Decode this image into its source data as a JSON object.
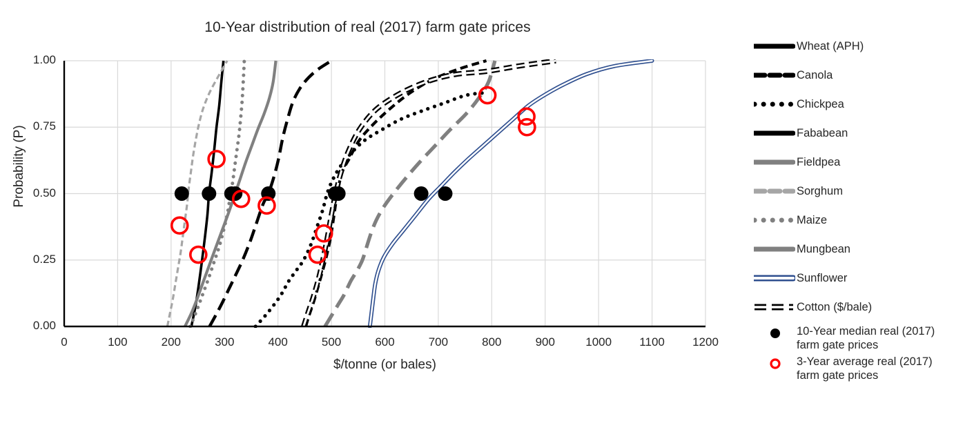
{
  "chart_data": {
    "type": "line",
    "title": "10-Year distribution of real (2017) farm gate prices",
    "xlabel": "$/tonne (or bales)",
    "ylabel": "Probability (P)",
    "xlim": [
      0,
      1200
    ],
    "ylim": [
      0,
      1
    ],
    "xticks": [
      0,
      100,
      200,
      300,
      400,
      500,
      600,
      700,
      800,
      900,
      1000,
      1100,
      1200
    ],
    "xtick_labels": [
      "0",
      "100",
      "200",
      "300",
      "400",
      "500",
      "600",
      "700",
      "800",
      "900",
      "1000",
      "1100",
      "1200"
    ],
    "yticks": [
      0,
      0.25,
      0.5,
      0.75,
      1.0
    ],
    "ytick_labels": [
      "0.00",
      "0.25",
      "0.50",
      "0.75",
      "1.00"
    ],
    "grid": true,
    "legend_position": "right",
    "series": [
      {
        "name": "Wheat (APH)",
        "style": "solid",
        "color": "#000000",
        "width": 3.6,
        "points": [
          [
            238,
            0.0
          ],
          [
            246,
            0.08
          ],
          [
            252,
            0.16
          ],
          [
            258,
            0.25
          ],
          [
            263,
            0.33
          ],
          [
            268,
            0.42
          ],
          [
            271,
            0.5
          ],
          [
            276,
            0.58
          ],
          [
            281,
            0.67
          ],
          [
            285,
            0.75
          ],
          [
            290,
            0.83
          ],
          [
            294,
            0.92
          ],
          [
            298,
            1.0
          ]
        ]
      },
      {
        "name": "Canola",
        "style": "dashed",
        "color": "#000000",
        "width": 4.2,
        "points": [
          [
            452,
            0.0
          ],
          [
            458,
            0.04
          ],
          [
            468,
            0.1
          ],
          [
            478,
            0.17
          ],
          [
            489,
            0.25
          ],
          [
            498,
            0.33
          ],
          [
            505,
            0.42
          ],
          [
            511,
            0.5
          ],
          [
            520,
            0.58
          ],
          [
            533,
            0.63
          ],
          [
            552,
            0.7
          ],
          [
            578,
            0.76
          ],
          [
            610,
            0.82
          ],
          [
            648,
            0.88
          ],
          [
            690,
            0.93
          ],
          [
            740,
            0.97
          ],
          [
            790,
            1.0
          ]
        ]
      },
      {
        "name": "Chickpea",
        "style": "dotted",
        "color": "#000000",
        "width": 5.2,
        "points": [
          [
            358,
            0.0
          ],
          [
            376,
            0.04
          ],
          [
            392,
            0.08
          ],
          [
            406,
            0.12
          ],
          [
            420,
            0.17
          ],
          [
            434,
            0.21
          ],
          [
            448,
            0.25
          ],
          [
            462,
            0.31
          ],
          [
            474,
            0.38
          ],
          [
            484,
            0.44
          ],
          [
            492,
            0.5
          ],
          [
            502,
            0.55
          ],
          [
            516,
            0.6
          ],
          [
            536,
            0.65
          ],
          [
            562,
            0.7
          ],
          [
            594,
            0.74
          ],
          [
            630,
            0.78
          ],
          [
            668,
            0.81
          ],
          [
            710,
            0.84
          ],
          [
            752,
            0.87
          ],
          [
            790,
            0.88
          ]
        ]
      },
      {
        "name": "Fababean",
        "style": "long-dash",
        "color": "#000000",
        "width": 4.4,
        "points": [
          [
            272,
            0.0
          ],
          [
            283,
            0.04
          ],
          [
            296,
            0.09
          ],
          [
            308,
            0.14
          ],
          [
            320,
            0.19
          ],
          [
            334,
            0.25
          ],
          [
            348,
            0.32
          ],
          [
            360,
            0.39
          ],
          [
            372,
            0.46
          ],
          [
            382,
            0.5
          ],
          [
            392,
            0.56
          ],
          [
            401,
            0.63
          ],
          [
            409,
            0.71
          ],
          [
            418,
            0.78
          ],
          [
            429,
            0.85
          ],
          [
            446,
            0.91
          ],
          [
            470,
            0.96
          ],
          [
            500,
            1.0
          ]
        ]
      },
      {
        "name": "Fieldpea",
        "style": "solid",
        "color": "#808080",
        "width": 4.2,
        "points": [
          [
            226,
            0.0
          ],
          [
            238,
            0.05
          ],
          [
            248,
            0.1
          ],
          [
            257,
            0.15
          ],
          [
            266,
            0.2
          ],
          [
            275,
            0.25
          ],
          [
            286,
            0.31
          ],
          [
            297,
            0.37
          ],
          [
            308,
            0.43
          ],
          [
            320,
            0.5
          ],
          [
            330,
            0.56
          ],
          [
            340,
            0.62
          ],
          [
            351,
            0.68
          ],
          [
            362,
            0.74
          ],
          [
            374,
            0.8
          ],
          [
            384,
            0.86
          ],
          [
            391,
            0.92
          ],
          [
            396,
            1.0
          ]
        ]
      },
      {
        "name": "Sorghum",
        "style": "dashed",
        "color": "#a6a6a6",
        "width": 3.2,
        "points": [
          [
            193,
            0.0
          ],
          [
            198,
            0.05
          ],
          [
            203,
            0.1
          ],
          [
            208,
            0.16
          ],
          [
            213,
            0.22
          ],
          [
            218,
            0.28
          ],
          [
            222,
            0.34
          ],
          [
            226,
            0.4
          ],
          [
            230,
            0.46
          ],
          [
            233,
            0.52
          ],
          [
            237,
            0.58
          ],
          [
            241,
            0.64
          ],
          [
            246,
            0.7
          ],
          [
            252,
            0.76
          ],
          [
            260,
            0.82
          ],
          [
            272,
            0.88
          ],
          [
            288,
            0.94
          ],
          [
            305,
            1.0
          ]
        ]
      },
      {
        "name": "Maize",
        "style": "dotted",
        "color": "#808080",
        "width": 5.0,
        "points": [
          [
            236,
            0.0
          ],
          [
            248,
            0.06
          ],
          [
            259,
            0.12
          ],
          [
            270,
            0.18
          ],
          [
            280,
            0.24
          ],
          [
            290,
            0.3
          ],
          [
            298,
            0.36
          ],
          [
            305,
            0.42
          ],
          [
            310,
            0.48
          ],
          [
            315,
            0.54
          ],
          [
            319,
            0.6
          ],
          [
            323,
            0.66
          ],
          [
            327,
            0.72
          ],
          [
            330,
            0.78
          ],
          [
            333,
            0.85
          ],
          [
            335,
            0.92
          ],
          [
            337,
            1.0
          ]
        ]
      },
      {
        "name": "Mungbean",
        "style": "long-dash",
        "color": "#808080",
        "width": 5.2,
        "points": [
          [
            488,
            0.0
          ],
          [
            500,
            0.04
          ],
          [
            512,
            0.08
          ],
          [
            524,
            0.12
          ],
          [
            536,
            0.17
          ],
          [
            548,
            0.21
          ],
          [
            558,
            0.25
          ],
          [
            566,
            0.3
          ],
          [
            574,
            0.35
          ],
          [
            584,
            0.4
          ],
          [
            598,
            0.45
          ],
          [
            616,
            0.5
          ],
          [
            640,
            0.56
          ],
          [
            666,
            0.62
          ],
          [
            694,
            0.68
          ],
          [
            722,
            0.74
          ],
          [
            752,
            0.8
          ],
          [
            776,
            0.86
          ],
          [
            794,
            0.92
          ],
          [
            806,
            1.0
          ]
        ]
      },
      {
        "name": "Sunflower",
        "style": "double-line",
        "color": "#2f4f8f",
        "width": 2.0,
        "points": [
          [
            572,
            0.0
          ],
          [
            575,
            0.05
          ],
          [
            578,
            0.1
          ],
          [
            582,
            0.16
          ],
          [
            588,
            0.21
          ],
          [
            598,
            0.26
          ],
          [
            614,
            0.31
          ],
          [
            634,
            0.36
          ],
          [
            658,
            0.42
          ],
          [
            682,
            0.48
          ],
          [
            706,
            0.53
          ],
          [
            730,
            0.58
          ],
          [
            756,
            0.63
          ],
          [
            784,
            0.68
          ],
          [
            812,
            0.73
          ],
          [
            840,
            0.78
          ],
          [
            868,
            0.83
          ],
          [
            898,
            0.87
          ],
          [
            934,
            0.91
          ],
          [
            978,
            0.95
          ],
          [
            1030,
            0.98
          ],
          [
            1100,
            1.0
          ]
        ]
      },
      {
        "name": "Cotton ($/bale)",
        "style": "dashed-hollow",
        "color": "#000000",
        "width": 4.0,
        "points": [
          [
            448,
            0.0
          ],
          [
            456,
            0.05
          ],
          [
            466,
            0.11
          ],
          [
            476,
            0.18
          ],
          [
            484,
            0.25
          ],
          [
            492,
            0.33
          ],
          [
            500,
            0.42
          ],
          [
            508,
            0.5
          ],
          [
            518,
            0.58
          ],
          [
            532,
            0.66
          ],
          [
            552,
            0.74
          ],
          [
            580,
            0.81
          ],
          [
            614,
            0.86
          ],
          [
            652,
            0.9
          ],
          [
            692,
            0.93
          ],
          [
            736,
            0.95
          ],
          [
            790,
            0.96
          ],
          [
            850,
            0.98
          ],
          [
            920,
            1.0
          ]
        ]
      }
    ],
    "median_markers": {
      "label": "10-Year median real (2017) farm gate prices",
      "color": "#000000",
      "probability": 0.5,
      "points": [
        {
          "crop": "Sorghum",
          "value": 220
        },
        {
          "crop": "Wheat (APH)",
          "value": 271
        },
        {
          "crop": "Maize",
          "value": 313
        },
        {
          "crop": "Fieldpea",
          "value": 320
        },
        {
          "crop": "Fababean",
          "value": 382
        },
        {
          "crop": "Canola",
          "value": 507
        },
        {
          "crop": "Cotton ($/bale)",
          "value": 513
        },
        {
          "crop": "Mungbean",
          "value": 668
        },
        {
          "crop": "Sunflower",
          "value": 713
        }
      ]
    },
    "average_markers": {
      "label": "3-Year average real (2017) farm gate prices",
      "color": "#ff0000",
      "points": [
        {
          "crop": "Sorghum",
          "value": 216,
          "probability": 0.38
        },
        {
          "crop": "Wheat (APH)",
          "value": 251,
          "probability": 0.27
        },
        {
          "crop": "Wheat (APH) upper",
          "value": 285,
          "probability": 0.63
        },
        {
          "crop": "Maize",
          "value": 331,
          "probability": 0.48
        },
        {
          "crop": "Fieldpea",
          "value": 379,
          "probability": 0.455
        },
        {
          "crop": "Cotton ($/bale)",
          "value": 486,
          "probability": 0.35
        },
        {
          "crop": "Canola",
          "value": 474,
          "probability": 0.27
        },
        {
          "crop": "Chickpea",
          "value": 792,
          "probability": 0.87
        },
        {
          "crop": "Mungbean",
          "value": 865,
          "probability": 0.79
        },
        {
          "crop": "Sunflower",
          "value": 866,
          "probability": 0.75
        }
      ]
    }
  },
  "legend": {
    "items": [
      {
        "label": "Wheat (APH)",
        "style": "solid",
        "color": "#000000"
      },
      {
        "label": "Canola",
        "style": "dashed",
        "color": "#000000"
      },
      {
        "label": "Chickpea",
        "style": "dotted",
        "color": "#000000"
      },
      {
        "label": "Fababean",
        "style": "long-dash",
        "color": "#000000"
      },
      {
        "label": "Fieldpea",
        "style": "solid",
        "color": "#808080"
      },
      {
        "label": "Sorghum",
        "style": "dashed",
        "color": "#a6a6a6"
      },
      {
        "label": "Maize",
        "style": "dotted",
        "color": "#808080"
      },
      {
        "label": "Mungbean",
        "style": "long-dash",
        "color": "#808080"
      },
      {
        "label": "Sunflower",
        "style": "double-line",
        "color": "#2f4f8f"
      },
      {
        "label": "Cotton ($/bale)",
        "style": "dashed-hollow",
        "color": "#000000"
      }
    ],
    "markers": [
      {
        "label": "10-Year median real (2017) farm gate prices",
        "glyph": "filled-circle",
        "color": "#000000"
      },
      {
        "label": "3-Year average real (2017) farm gate prices",
        "glyph": "hollow-red-circle",
        "color": "#ff0000"
      }
    ]
  }
}
